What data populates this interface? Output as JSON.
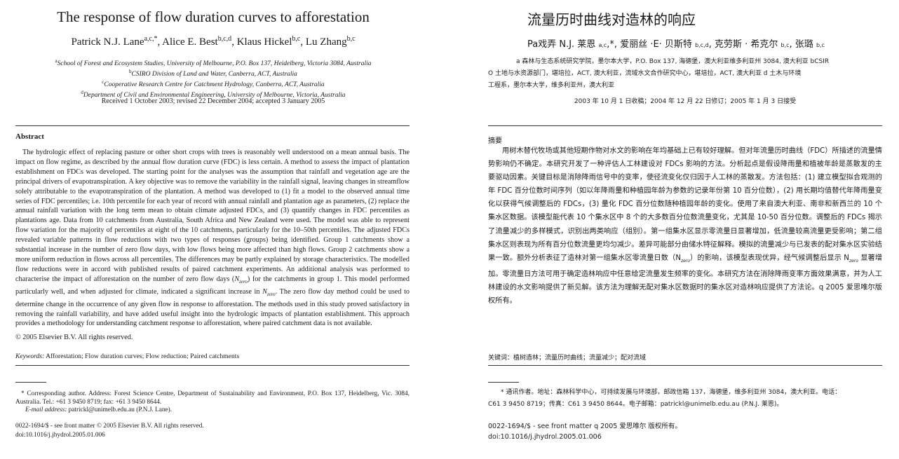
{
  "english": {
    "title": "The response of flow duration curves to afforestation",
    "authors": [
      {
        "name": "Patrick N.J. Lane",
        "sup": "a,c,*"
      },
      {
        "name": "Alice E. Best",
        "sup": "b,c,d"
      },
      {
        "name": "Klaus Hickel",
        "sup": "b,c"
      },
      {
        "name": "Lu Zhang",
        "sup": "b,c"
      }
    ],
    "affiliations": [
      {
        "sup": "a",
        "text": "School of Forest and Ecosystem Studies, University of Melbourne, P.O. Box 137, Heidelberg, Victoria 3084, Australia"
      },
      {
        "sup": "b",
        "text": "CSIRO Division of Land and Water, Canberra, ACT, Australia"
      },
      {
        "sup": "c",
        "text": "Cooperative Research Centre for Catchment Hydrology, Canberra, ACT, Australia"
      },
      {
        "sup": "d",
        "text": "Department of Civil and Environmental Engineering, University of Melbourne, Victoria, Australia"
      }
    ],
    "received": "Received 1 October 2003; revised 22 December 2004; accepted 3 January 2005",
    "abstract_heading": "Abstract",
    "abstract_part1": "The hydrologic effect of replacing pasture or other short crops with trees is reasonably well understood on a mean annual basis. The impact on flow regime, as described by the annual flow duration curve (FDC) is less certain. A method to assess the impact of plantation establishment on FDCs was developed. The starting point for the analyses was the assumption that rainfall and vegetation age are the principal drivers of evapotranspiration. A key objective was to remove the variability in the rainfall signal, leaving changes in streamflow solely attributable to the evapotranspiration of the plantation. A method was developed to (1) fit a model to the observed annual time series of FDC percentiles; i.e. 10th percentile for each year of record with annual rainfall and plantation age as parameters, (2) replace the annual rainfall variation with the long term mean to obtain climate adjusted FDCs, and (3) quantify changes in FDC percentiles as plantations age. Data from 10 catchments from Australia, South Africa and New Zealand were used. The model was able to represent flow variation for the majority of percentiles at eight of the 10 catchments, particularly for the 10–50th percentiles. The adjusted FDCs revealed variable patterns in flow reductions with two types of responses (groups) being identified. Group 1 catchments show a substantial increase in the number of zero flow days, with low flows being more affected than high flows. Group 2 catchments show a more uniform reduction in flows across all percentiles. The differences may be partly explained by storage characteristics. The modelled flow reductions were in accord with published results of paired catchment experiments. An additional analysis was performed to characterise the impact of afforestation on the number of zero flow days (",
    "nzero_base": "N",
    "nzero_sub": "zero",
    "abstract_part2": ") for the catchments in group 1. This model performed particularly well, and when adjusted for climate, indicated a significant increase in ",
    "abstract_part3": ". The zero flow day method could be used to determine change in the occurrence of any given flow in response to afforestation. The methods used in this study proved satisfactory in removing the rainfall variability, and have added useful insight into the hydrologic impacts of plantation establishment. This approach provides a methodology for understanding catchment response to afforestation, where paired catchment data is not available.",
    "copyright": "© 2005 Elsevier B.V. All rights reserved.",
    "keywords_label": "Keywords:",
    "keywords": "Afforestation; Flow duration curves; Flow reduction; Paired catchments",
    "footnote": "* Corresponding author. Address: Forest Science Centre, Department of Sustainability and Environment, P.O. Box 137, Heidelberg, Vic. 3084, Australia. Tel.: +61 3 9450 8719; fax: +61 3 9450 8644.",
    "email_label": "E-mail address:",
    "email": "patrickl@unimelb.edu.au (P.N.J. Lane).",
    "issn": "0022-1694/$ - see front matter © 2005 Elsevier B.V. All rights reserved.",
    "doi": "doi:10.1016/j.jhydrol.2005.01.006"
  },
  "chinese": {
    "title": "流量历时曲线对造林的响应",
    "authors_line_parts": [
      {
        "text": "Pa戏弄 N.J. 莱恩 ",
        "sup": "a,c"
      },
      {
        "text": ",*, 爱丽丝 ·E· 贝斯特 ",
        "sup": "b,c,d"
      },
      {
        "text": ", 克劳斯 · 希克尔 ",
        "sup": "b,c"
      },
      {
        "text": ", 张璐 ",
        "sup": "b,c"
      }
    ],
    "affiliation_lines": [
      "a 森林与生态系统研究学院，墨尔本大学，P.O. Box 137, 海德堡，澳大利亚维多利亚州 3084, 澳大利亚 bCSIR",
      "O 土地与水资源部门，堪培拉，ACT, 澳大利亚，流域水文合作研究中心，堪培拉，ACT, 澳大利亚 d 土木与环境",
      "工程系，墨尔本大学，维多利亚州，澳大利亚"
    ],
    "received": "2003 年 10 月 1 日收稿；2004 年 12 月 22 日修订；2005 年 1 月 3 日接受",
    "abstract_heading": "摘要",
    "abstract_part1": "用树木替代牧场或其他短期作物对水文的影响在年均基础上已有较好理解。但对年流量历时曲线（FDC）所描述的流量情势影响仍不确定。本研究开发了一种评估人工林建设对 FDCs 影响的方法。分析起点是假设降雨量和植被年龄是蒸散发的主要驱动因素。关键目标是消除降雨信号中的变率，使径流变化仅归因于人工林的蒸散发。方法包括：(1) 建立模型拟合观测的年 FDC 百分位数时间序列（如以年降雨量和种植园年龄为参数的记录年份第 10 百分位数），(2) 用长期均值替代年降雨量变化以获得气候调整后的 FDCs，(3) 量化 FDC 百分位数随种植园年龄的变化。使用了来自澳大利亚、南非和新西兰的 10 个集水区数据。该模型能代表 10 个集水区中 8 个的大多数百分位数流量变化，尤其是 10-50 百分位数。调整后的 FDCs 揭示了流量减少的多样模式，识别出两类响应（组别）。第一组集水区显示零流量日显著增加，低流量较高流量更受影响；第二组集水区则表现为所有百分位数流量更均匀减少。差异可能部分由储水特征解释。模拟的流量减少与已发表的配对集水区实验结果一致。额外分析表征了造林对第一组集水区零流量日数（N",
    "nzero_sub": "zero",
    "abstract_part2": "）的影响，该模型表现优异，经气候调整后显示 N",
    "abstract_part3": " 显著增加。零流量日方法可用于确定造林响应中任意给定流量发生频率的变化。本研究方法在消除降雨变率方面效果满意，并为人工林建设的水文影响提供了新见解。该方法为理解无配对集水区数据时的集水区对造林响应提供了方法论。q 2005 爱思唯尔版权所有。",
    "keywords": "关键词：植树造林；流量历时曲线；流量减少；配对流域",
    "footnote_line1": "* 通讯作者。地址：森林科学中心，可持续发展与环境部，邮政信箱 137，海德堡，维多利亚州 3084，澳大利亚。电话：",
    "footnote_line2": "C61 3 9450 8719；传真：C61 3 9450 8644。电子邮箱：patrickl@unimelb.edu.au (P.N.J. 莱恩)。",
    "issn": "0022-1694/$ - see front matter q 2005 爱思唯尔 版权所有。",
    "doi": "doi:10.1016/j.jhydrol.2005.01.006"
  }
}
